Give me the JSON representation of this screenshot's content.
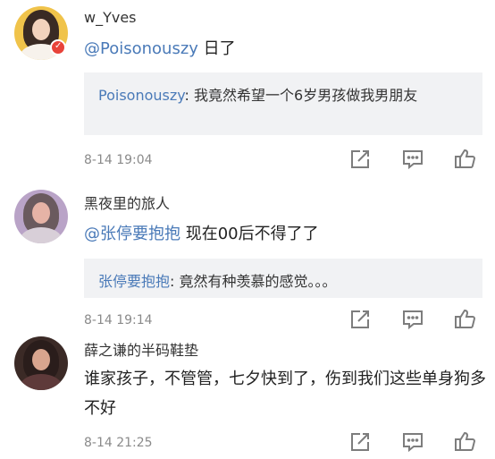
{
  "comments": [
    {
      "username": "w_Yves",
      "mention": "@Poisonouszy",
      "text": " 日了",
      "quote_name": "Poisonouszy",
      "quote_text": ": 我竟然希望一个6岁男孩做我男朋友",
      "time": "8-14 19:04"
    },
    {
      "username": "黑夜里的旅人",
      "mention": "@张停要抱抱",
      "text": " 现在00后不得了了",
      "quote_name": "张停要抱抱",
      "quote_text": ": 竟然有种羡慕的感觉。。。",
      "time": "8-14 19:14"
    },
    {
      "username": "薛之谦的半码鞋垫",
      "text": "谁家孩子，不管管，七夕快到了，伤到我们这些单身狗多不好",
      "time": "8-14 21:25"
    }
  ],
  "icons": [
    "avatar",
    "verified-badge-icon",
    "share-icon",
    "comment-icon",
    "like-icon"
  ],
  "colors": {
    "mention": "#4a7ab8",
    "quote_bg": "#f1f2f4",
    "time": "#8a8a8a",
    "badge": "#e8433a"
  }
}
